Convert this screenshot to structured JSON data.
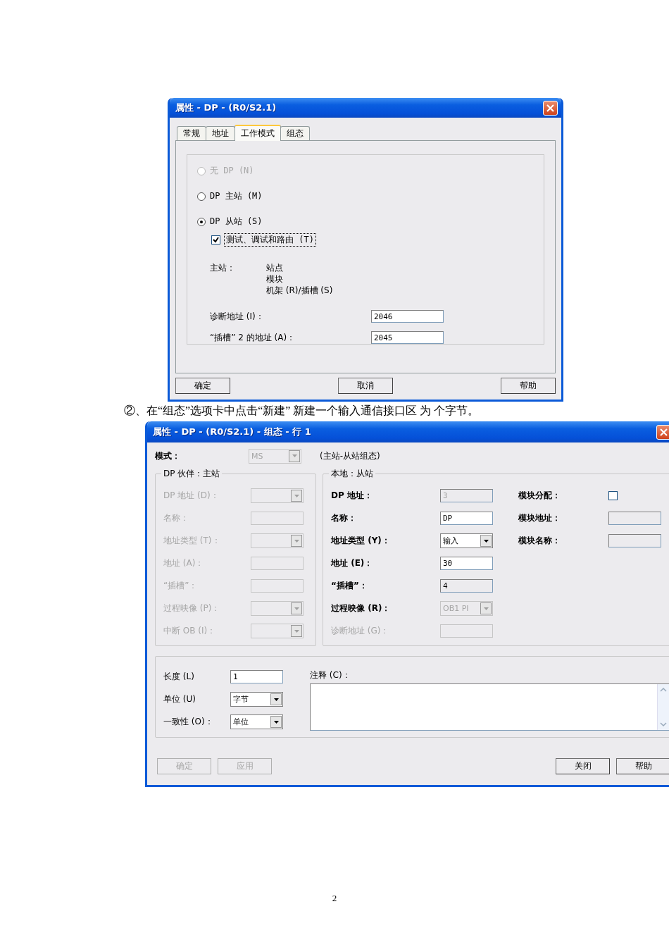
{
  "dialog_1": {
    "title": "属性 - DP - (R0/S2.1)",
    "tabs": [
      {
        "label": "常规",
        "selected": false
      },
      {
        "label": "地址",
        "selected": false
      },
      {
        "label": "工作模式",
        "selected": true
      },
      {
        "label": "组态",
        "selected": false
      }
    ],
    "options": [
      {
        "label": "无 DP (N)",
        "selected": false,
        "disabled": true
      },
      {
        "label": "DP 主站 (M)",
        "selected": false,
        "disabled": false
      },
      {
        "label": "DP 从站 (S)",
        "selected": true,
        "disabled": false
      }
    ],
    "checkbox": {
      "label": "测试、调试和路由 (T)",
      "checked": true
    },
    "master": {
      "label": "主站：",
      "lines": [
        "站点",
        "模块",
        "机架 (R)/插槽 (S)"
      ]
    },
    "fields": [
      {
        "label": "诊断地址 (I)：",
        "value": "2046"
      },
      {
        "label": "“插槽” 2 的地址 (A)：",
        "value": "2045"
      }
    ],
    "buttons": [
      "确定",
      "取消",
      "帮助"
    ]
  },
  "caption": "②、在“组态”选项卡中点击“新建” 新建一个输入通信接口区 为 个字节。",
  "dialog_2": {
    "title": "属性 - DP - (R0/S2.1) - 组态 - 行 1",
    "mode": {
      "label": "模式：",
      "value": "MS",
      "disabled": true,
      "note": "(主站-从站组态)"
    },
    "partner": {
      "title": "DP 伙伴：主站",
      "rows": [
        {
          "label": "DP 地址 (D)：",
          "kind": "dropdown",
          "disabled": true
        },
        {
          "label": "名称：",
          "kind": "text",
          "disabled": true
        },
        {
          "label": "地址类型 (T)：",
          "kind": "dropdown",
          "disabled": true
        },
        {
          "label": "地址 (A)：",
          "kind": "text",
          "disabled": true
        },
        {
          "label": "“插槽”：",
          "kind": "text",
          "disabled": true
        },
        {
          "label": "过程映像 (P)：",
          "kind": "dropdown",
          "disabled": true
        },
        {
          "label": "中断 OB (I)：",
          "kind": "dropdown",
          "disabled": true
        }
      ]
    },
    "local": {
      "title": "本地：从站",
      "rows": [
        {
          "label": "DP 地址：",
          "kind": "text",
          "value": "3",
          "readonly": true
        },
        {
          "label": "名称：",
          "kind": "text",
          "value": "DP",
          "readonly": false
        },
        {
          "label": "地址类型 (Y)：",
          "kind": "dropdown",
          "value": "输入",
          "readonly": false
        },
        {
          "label": "地址 (E)：",
          "kind": "text",
          "value": "30",
          "readonly": false
        },
        {
          "label": "“插槽”：",
          "kind": "text",
          "value": "4",
          "readonly": true
        },
        {
          "label": "过程映像 (R)：",
          "kind": "dropdown",
          "value": "OB1 PI",
          "readonly": true
        },
        {
          "label": "诊断地址 (G)：",
          "kind": "text",
          "disabled": true
        }
      ],
      "module": [
        {
          "label": "模块分配：",
          "kind": "checkbox",
          "checked": false
        },
        {
          "label": "模块地址：",
          "kind": "text",
          "readonly": true
        },
        {
          "label": "模块名称：",
          "kind": "text",
          "readonly": true
        }
      ]
    },
    "length": [
      {
        "label": "长度 (L)",
        "kind": "text",
        "value": "1"
      },
      {
        "label": "单位 (U)",
        "kind": "dropdown",
        "value": "字节"
      },
      {
        "label": "一致性 (O)：",
        "kind": "dropdown",
        "value": "单位"
      }
    ],
    "comment": {
      "label": "注释 (C)："
    },
    "buttons": [
      {
        "label": "确定",
        "disabled": true
      },
      {
        "label": "应用",
        "disabled": true
      },
      {
        "label": "关闭",
        "disabled": false
      },
      {
        "label": "帮助",
        "disabled": false
      }
    ]
  },
  "page_number": "2"
}
